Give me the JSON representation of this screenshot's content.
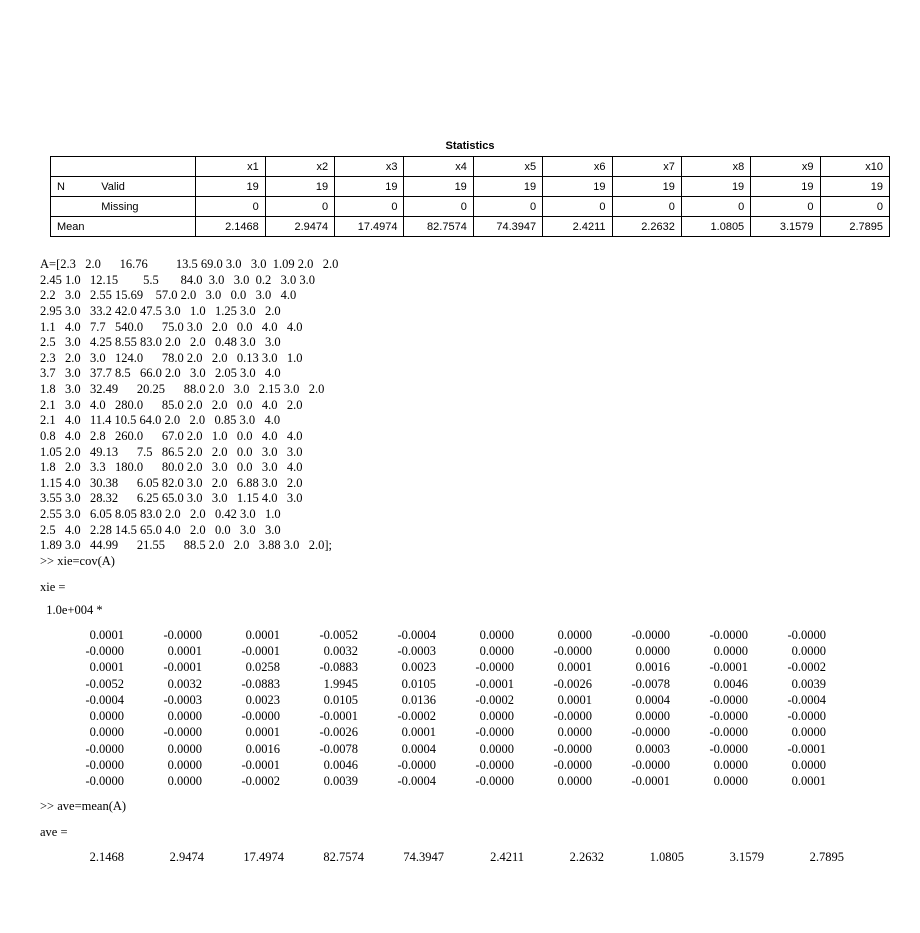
{
  "table": {
    "title": "Statistics",
    "columns": [
      "x1",
      "x2",
      "x3",
      "x4",
      "x5",
      "x6",
      "x7",
      "x8",
      "x9",
      "x10"
    ],
    "rows": {
      "n_label": "N",
      "valid_label": "Valid",
      "missing_label": "Missing",
      "mean_label": "Mean",
      "valid": [
        "19",
        "19",
        "19",
        "19",
        "19",
        "19",
        "19",
        "19",
        "19",
        "19"
      ],
      "missing": [
        "0",
        "0",
        "0",
        "0",
        "0",
        "0",
        "0",
        "0",
        "0",
        "0"
      ],
      "mean": [
        "2.1468",
        "2.9474",
        "17.4974",
        "82.7574",
        "74.3947",
        "2.4211",
        "2.2632",
        "1.0805",
        "3.1579",
        "2.7895"
      ]
    }
  },
  "code": {
    "A_block": "A=[2.3   2.0      16.76         13.5 69.0 3.0   3.0  1.09 2.0   2.0\n2.45 1.0   12.15        5.5       84.0  3.0   3.0  0.2   3.0 3.0\n2.2   3.0   2.55 15.69    57.0 2.0   3.0   0.0   3.0   4.0\n2.95 3.0   33.2 42.0 47.5 3.0   1.0   1.25 3.0   2.0\n1.1   4.0   7.7   540.0      75.0 3.0   2.0   0.0   4.0   4.0\n2.5   3.0   4.25 8.55 83.0 2.0   2.0   0.48 3.0   3.0\n2.3   2.0   3.0   124.0      78.0 2.0   2.0   0.13 3.0   1.0\n3.7   3.0   37.7 8.5   66.0 2.0   3.0   2.05 3.0   4.0\n1.8   3.0   32.49      20.25      88.0 2.0   3.0   2.15 3.0   2.0\n2.1   3.0   4.0   280.0      85.0 2.0   2.0   0.0   4.0   2.0\n2.1   4.0   11.4 10.5 64.0 2.0   2.0   0.85 3.0   4.0\n0.8   4.0   2.8   260.0      67.0 2.0   1.0   0.0   4.0   4.0\n1.05 2.0   49.13      7.5   86.5 2.0   2.0   0.0   3.0   3.0\n1.8   2.0   3.3   180.0      80.0 2.0   3.0   0.0   3.0   4.0\n1.15 4.0   30.38      6.05 82.0 3.0   2.0   6.88 3.0   2.0\n3.55 3.0   28.32      6.25 65.0 3.0   3.0   1.15 4.0   3.0\n2.55 3.0   6.05 8.05 83.0 2.0   2.0   0.42 3.0   1.0\n2.5   4.0   2.28 14.5 65.0 4.0   2.0   0.0   3.0   3.0\n1.89 3.0   44.99      21.55      88.5 2.0   2.0   3.88 3.0   2.0];\n>> xie=cov(A)",
    "xie_label": "xie =",
    "scale_label": "  1.0e+004 *",
    "ave_cmd": ">> ave=mean(A)",
    "ave_label": "ave ="
  },
  "xie_matrix": [
    [
      "0.0001",
      "-0.0000",
      "0.0001",
      "-0.0052",
      "-0.0004",
      "0.0000",
      "0.0000",
      "-0.0000",
      "-0.0000",
      "-0.0000"
    ],
    [
      "-0.0000",
      "0.0001",
      "-0.0001",
      "0.0032",
      "-0.0003",
      "0.0000",
      "-0.0000",
      "0.0000",
      "0.0000",
      "0.0000"
    ],
    [
      "0.0001",
      "-0.0001",
      "0.0258",
      "-0.0883",
      "0.0023",
      "-0.0000",
      "0.0001",
      "0.0016",
      "-0.0001",
      "-0.0002"
    ],
    [
      "-0.0052",
      "0.0032",
      "-0.0883",
      "1.9945",
      "0.0105",
      "-0.0001",
      "-0.0026",
      "-0.0078",
      "0.0046",
      "0.0039"
    ],
    [
      "-0.0004",
      "-0.0003",
      "0.0023",
      "0.0105",
      "0.0136",
      "-0.0002",
      "0.0001",
      "0.0004",
      "-0.0000",
      "-0.0004"
    ],
    [
      "0.0000",
      "0.0000",
      "-0.0000",
      "-0.0001",
      "-0.0002",
      "0.0000",
      "-0.0000",
      "0.0000",
      "-0.0000",
      "-0.0000"
    ],
    [
      "0.0000",
      "-0.0000",
      "0.0001",
      "-0.0026",
      "0.0001",
      "-0.0000",
      "0.0000",
      "-0.0000",
      "-0.0000",
      "0.0000"
    ],
    [
      "-0.0000",
      "0.0000",
      "0.0016",
      "-0.0078",
      "0.0004",
      "0.0000",
      "-0.0000",
      "0.0003",
      "-0.0000",
      "-0.0001"
    ],
    [
      "-0.0000",
      "0.0000",
      "-0.0001",
      "0.0046",
      "-0.0000",
      "-0.0000",
      "-0.0000",
      "-0.0000",
      "0.0000",
      "0.0000"
    ],
    [
      "-0.0000",
      "0.0000",
      "-0.0002",
      "0.0039",
      "-0.0004",
      "-0.0000",
      "0.0000",
      "-0.0001",
      "0.0000",
      "0.0001"
    ]
  ],
  "ave_vector": [
    "2.1468",
    "2.9474",
    "17.4974",
    "82.7574",
    "74.3947",
    "2.4211",
    "2.2632",
    "1.0805",
    "3.1579",
    "2.7895"
  ]
}
